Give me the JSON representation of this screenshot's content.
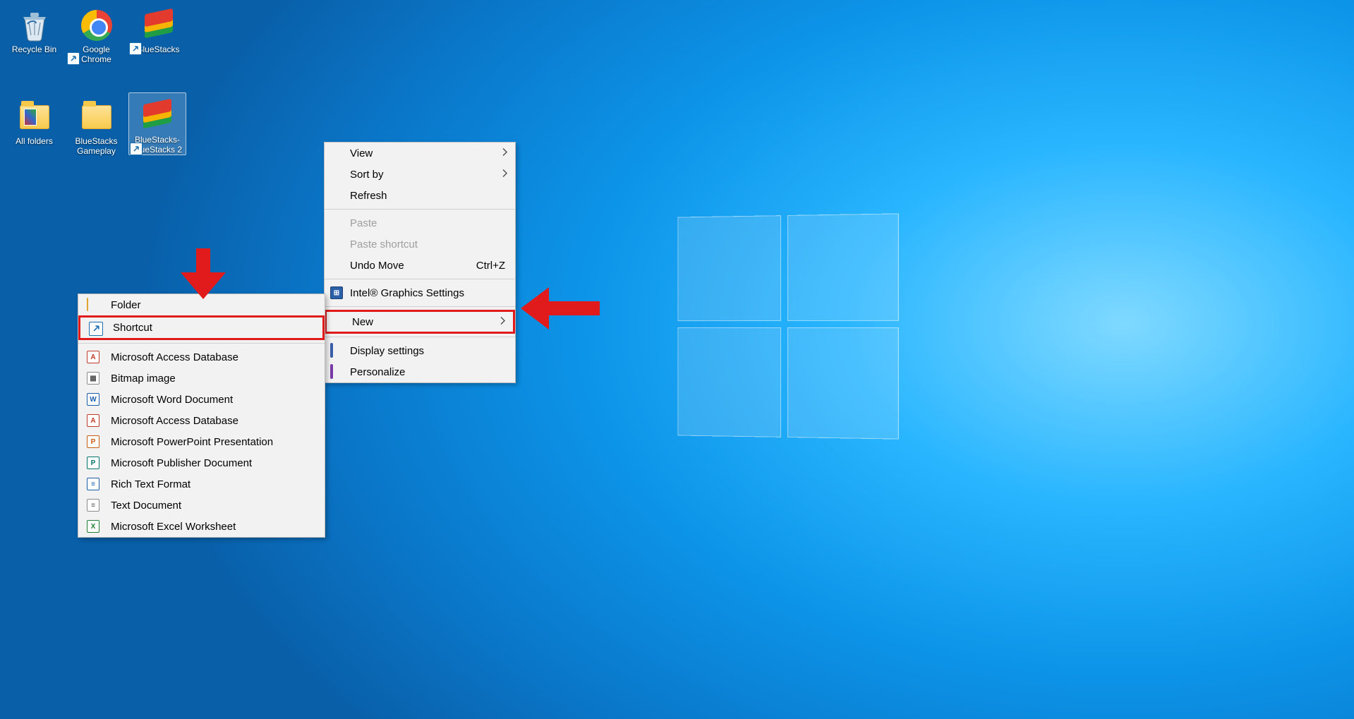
{
  "desktop_icons": {
    "recycle": "Recycle Bin",
    "chrome": "Google Chrome",
    "bluestacks": "BlueStacks",
    "all_folders": "All folders",
    "bs_gameplay": "BlueStacks Gameplay",
    "bs2": "BlueStacks-BlueStacks 2"
  },
  "context_menu": {
    "view": "View",
    "sort_by": "Sort by",
    "refresh": "Refresh",
    "paste": "Paste",
    "paste_shortcut": "Paste shortcut",
    "undo_move": "Undo Move",
    "undo_kbd": "Ctrl+Z",
    "graphics": "Intel® Graphics Settings",
    "new": "New",
    "display": "Display settings",
    "personalize": "Personalize"
  },
  "new_submenu": {
    "folder": "Folder",
    "shortcut": "Shortcut",
    "access1": "Microsoft Access Database",
    "bitmap": "Bitmap image",
    "word": "Microsoft Word Document",
    "access2": "Microsoft Access Database",
    "ppt": "Microsoft PowerPoint Presentation",
    "publisher": "Microsoft Publisher Document",
    "rtf": "Rich Text Format",
    "txt": "Text Document",
    "excel": "Microsoft Excel Worksheet"
  }
}
